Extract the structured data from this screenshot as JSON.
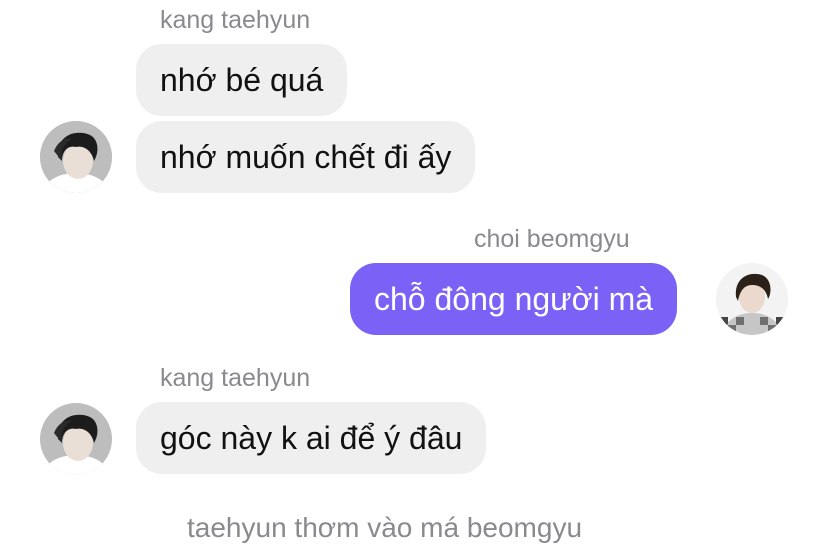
{
  "chat": {
    "messages": [
      {
        "sender": "kang taehyun",
        "text": "nhớ bé quá"
      },
      {
        "text": "nhớ muốn chết đi ấy"
      },
      {
        "sender": "choi beomgyu",
        "text": "chỗ đông người mà"
      },
      {
        "sender": "kang taehyun",
        "text": "góc này k ai để ý đâu"
      }
    ],
    "event": "taehyun thơm vào má beomgyu"
  },
  "colors": {
    "outgoing_bubble": "#7b61f5",
    "incoming_bubble": "#efeff0",
    "sender_name": "#8a8a8e"
  },
  "icons": {
    "incoming_avatar": "avatar-taehyun-icon",
    "outgoing_avatar": "avatar-beomgyu-icon"
  }
}
